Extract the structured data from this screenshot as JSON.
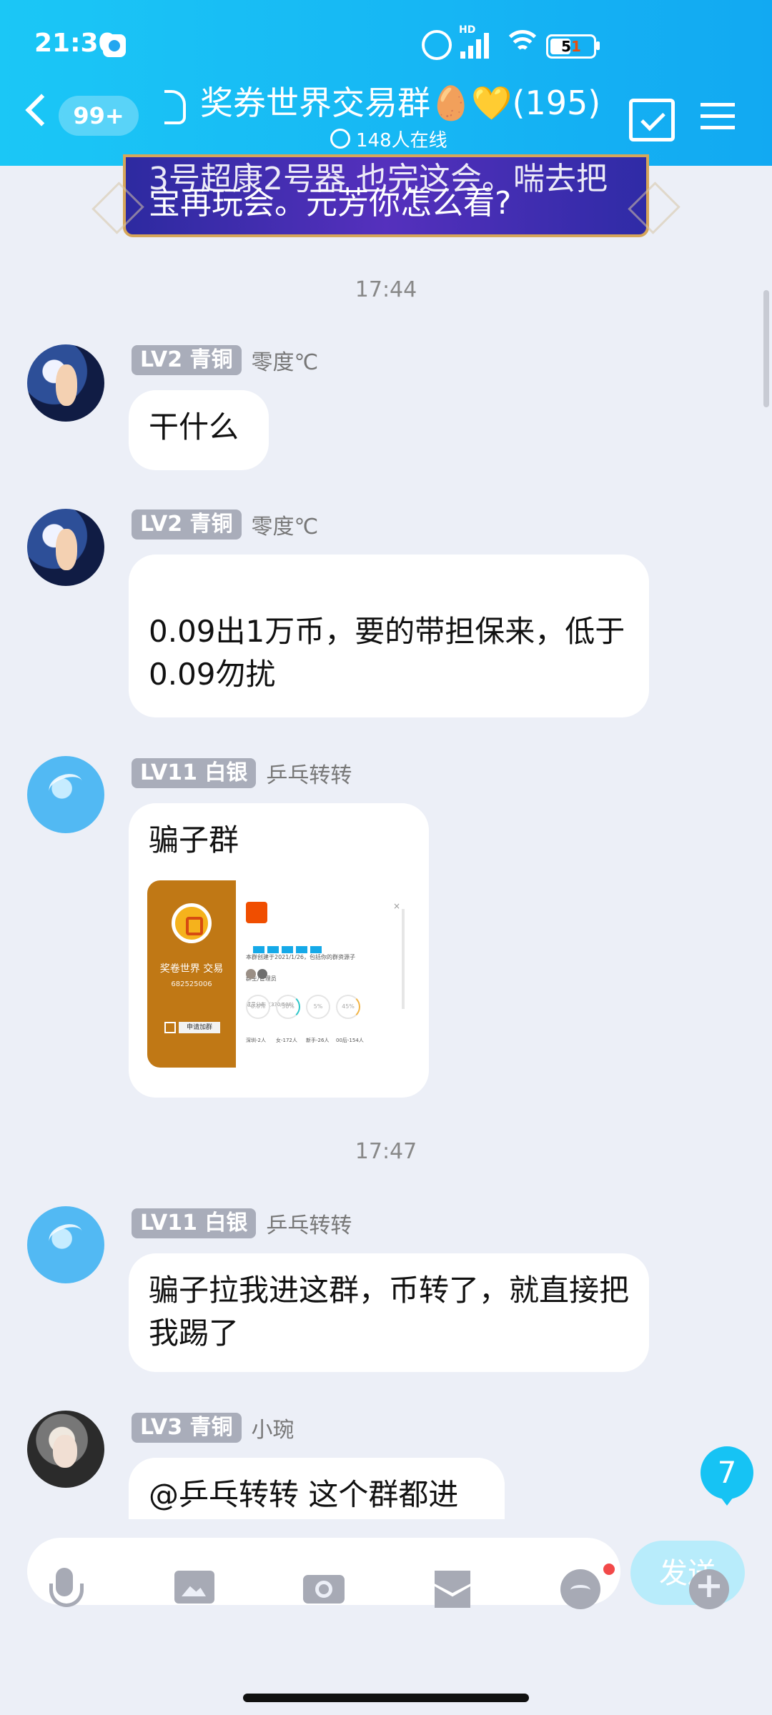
{
  "status_bar": {
    "time": "21:30",
    "battery": "51",
    "network_badge": "HD",
    "icons": [
      "alarm-icon",
      "signal-icon",
      "wifi-icon",
      "battery-icon"
    ]
  },
  "header": {
    "unread_count": "99+",
    "group_title": "奖券世界交易群🥚💛(195)",
    "online_text": "148人在线",
    "icons": [
      "back-icon",
      "ear-icon",
      "calendar-icon",
      "menu-icon"
    ]
  },
  "pinned_message": {
    "line1": "3号超康2号器 也完这会。喘去把",
    "line2": "宝再玩会。元芳你怎么看?"
  },
  "messages": {
    "time_divider_1": "17:44",
    "m1": {
      "level": "LV2 青铜",
      "sender": "零度℃",
      "text": "干什么"
    },
    "m2": {
      "level": "LV2 青铜",
      "sender": "零度℃",
      "text": "0.09出1万币，要的带担保来，低于0.09勿扰"
    },
    "m3": {
      "level": "LV11 白银",
      "sender": "乒乓转转",
      "text": "骗子群",
      "image": {
        "group_name": "奖卷世界 交易",
        "group_id": "682525006",
        "join_button": "申请加群",
        "intro_text": "本群创建于2021/1/26，包括你的群资源子",
        "members_label": "群主/管理员",
        "distribution_label": "成员分布（330/500）",
        "ring1": "0.6%",
        "ring2": "50%",
        "ring3": "5%",
        "ring4": "45%",
        "caption1": "深圳-2人",
        "caption2": "女-172人",
        "caption3": "新手-26人",
        "caption4": "00后-154人"
      }
    },
    "time_divider_2": "17:47",
    "m4": {
      "level": "LV11 白银",
      "sender": "乒乓转转",
      "text": "骗子拉我进这群，币转了，就直接把我踢了"
    },
    "m5": {
      "level": "LV3 青铜",
      "sender": "小琬",
      "text": "@乒乓转转 这个群都进"
    }
  },
  "new_message_count": "7",
  "composer": {
    "placeholder": "",
    "send_label": "发送",
    "toolbar_icons": [
      "microphone-icon",
      "image-icon",
      "camera-icon",
      "gift-icon",
      "emoji-icon",
      "plus-icon"
    ]
  },
  "colors": {
    "header": "#12a9f2",
    "background": "#eceff7",
    "bubble": "#ffffff",
    "badge": "#a9adba",
    "send_button": "#b8ecfb"
  }
}
